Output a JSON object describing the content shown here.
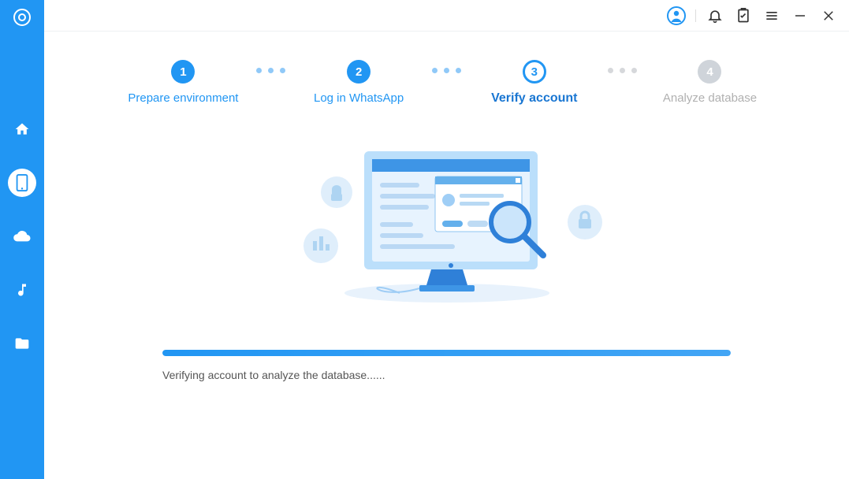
{
  "sidebar": {
    "items": [
      {
        "name": "home-icon"
      },
      {
        "name": "device-icon",
        "active": true
      },
      {
        "name": "cloud-icon"
      },
      {
        "name": "music-icon"
      },
      {
        "name": "folder-icon"
      }
    ]
  },
  "titlebar": {
    "items": [
      {
        "name": "account-icon"
      },
      {
        "name": "bell-icon"
      },
      {
        "name": "task-icon"
      },
      {
        "name": "menu-icon"
      },
      {
        "name": "minimize-icon"
      },
      {
        "name": "close-icon"
      }
    ]
  },
  "steps": [
    {
      "num": "1",
      "label": "Prepare environment",
      "state": "done"
    },
    {
      "num": "2",
      "label": "Log in WhatsApp",
      "state": "done"
    },
    {
      "num": "3",
      "label": "Verify account",
      "state": "current"
    },
    {
      "num": "4",
      "label": "Analyze database",
      "state": "future"
    }
  ],
  "progress": {
    "percent": "100",
    "text": "Verifying account to analyze the database......"
  }
}
